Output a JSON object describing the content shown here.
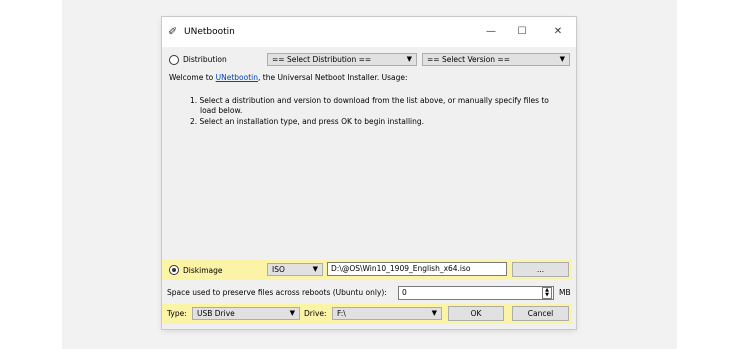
{
  "window": {
    "title": "UNetbootin",
    "minimize": "—",
    "maximize": "☐",
    "close": "✕"
  },
  "distribution": {
    "radio_label": "Distribution",
    "select_distribution": "== Select Distribution ==",
    "select_version": "== Select Version =="
  },
  "intro": {
    "prefix": "Welcome to ",
    "link": "UNetbootin",
    "suffix": ", the Universal Netboot Installer. Usage:",
    "step1": "1. Select a distribution and version to download from the list above, or manually specify files to",
    "step1b": "load below.",
    "step2": "2. Select an installation type, and press OK to begin installing."
  },
  "diskimage": {
    "radio_label": "Diskimage",
    "type": "ISO",
    "path": "D:\\@OS\\Win10_1909_English_x64.iso",
    "browse_label": "..."
  },
  "persist": {
    "label": "Space used to preserve files across reboots (Ubuntu only):",
    "value": "0",
    "unit": "MB"
  },
  "bottom": {
    "type_label": "Type:",
    "type_value": "USB Drive",
    "drive_label": "Drive:",
    "drive_value": "F:\\",
    "ok_label": "OK",
    "cancel_label": "Cancel"
  },
  "colors": {
    "highlight": "#fbf3a6",
    "link": "#0645ad"
  }
}
